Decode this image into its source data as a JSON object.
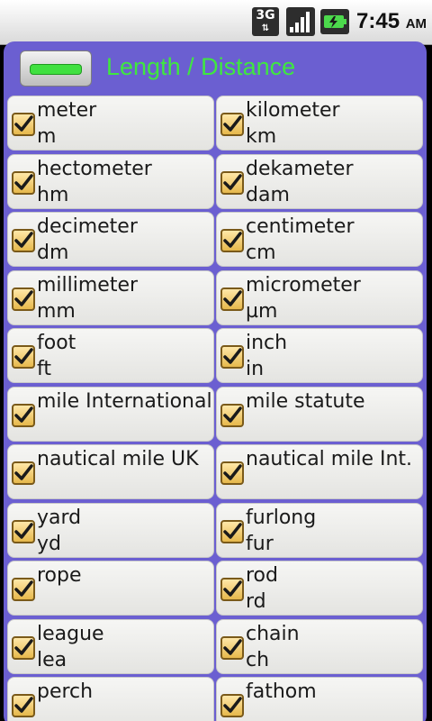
{
  "status_bar": {
    "network": "3G",
    "time": "7:45",
    "ampm": "AM"
  },
  "header": {
    "title": "Length / Distance"
  },
  "units": [
    {
      "name": "meter",
      "abbr": "m",
      "checked": true
    },
    {
      "name": "kilometer",
      "abbr": "km",
      "checked": true
    },
    {
      "name": "hectometer",
      "abbr": "hm",
      "checked": true
    },
    {
      "name": "dekameter",
      "abbr": "dam",
      "checked": true
    },
    {
      "name": "decimeter",
      "abbr": "dm",
      "checked": true
    },
    {
      "name": "centimeter",
      "abbr": "cm",
      "checked": true
    },
    {
      "name": "millimeter",
      "abbr": "mm",
      "checked": true
    },
    {
      "name": "micrometer",
      "abbr": "µm",
      "checked": true
    },
    {
      "name": "foot",
      "abbr": "ft",
      "checked": true
    },
    {
      "name": "inch",
      "abbr": "in",
      "checked": true
    },
    {
      "name": "mile International",
      "abbr": "",
      "checked": true
    },
    {
      "name": "mile statute",
      "abbr": "",
      "checked": true
    },
    {
      "name": "nautical mile UK",
      "abbr": "",
      "checked": true
    },
    {
      "name": "nautical mile Int.",
      "abbr": "",
      "checked": true
    },
    {
      "name": "yard",
      "abbr": "yd",
      "checked": true
    },
    {
      "name": "furlong",
      "abbr": "fur",
      "checked": true
    },
    {
      "name": "rope",
      "abbr": "",
      "checked": true
    },
    {
      "name": "rod",
      "abbr": "rd",
      "checked": true
    },
    {
      "name": "league",
      "abbr": "lea",
      "checked": true
    },
    {
      "name": "chain",
      "abbr": "ch",
      "checked": true
    },
    {
      "name": "perch",
      "abbr": "",
      "checked": true
    },
    {
      "name": "fathom",
      "abbr": "",
      "checked": true
    }
  ],
  "colors": {
    "panel_bg": "#6b5fd1",
    "title": "#3fe83f",
    "accent_green": "#40e040",
    "checkbox": "#e6b84c"
  }
}
